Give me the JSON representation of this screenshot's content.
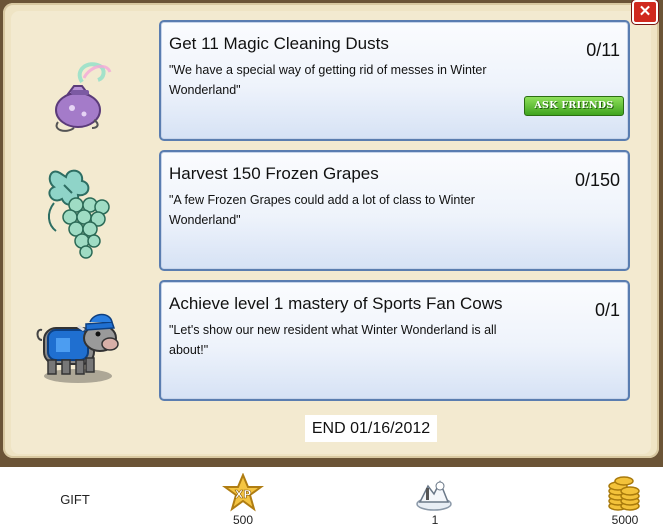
{
  "close_label": "✕",
  "quests": [
    {
      "title": "Get 11 Magic Cleaning Dusts",
      "description": "\"We have a special way of getting rid of messes in Winter Wonderland\"",
      "progress": "0/11",
      "button_label": "ASK FRIENDS",
      "icon": "magic-dust-bag-icon"
    },
    {
      "title": "Harvest 150 Frozen Grapes",
      "description": "\"A few Frozen Grapes could add a lot of class to Winter Wonderland\"",
      "progress": "0/150",
      "icon": "frozen-grapes-icon"
    },
    {
      "title": "Achieve level 1 mastery of Sports Fan Cows",
      "description": "\"Let's show our new resident what Winter Wonderland is all about!\"",
      "progress": "0/1",
      "icon": "sports-fan-cow-icon"
    }
  ],
  "end_date": "END 01/16/2012",
  "rewards": {
    "gift_label": "GIFT",
    "xp_value": "500",
    "xp_badge": "XP",
    "item_value": "1",
    "coins_value": "5000"
  },
  "colors": {
    "frame": "#6b5436",
    "panel": "#efe4c4",
    "quest_border": "#5a7db0",
    "button_green": "#3fa41e",
    "close_red": "#d0291f"
  }
}
